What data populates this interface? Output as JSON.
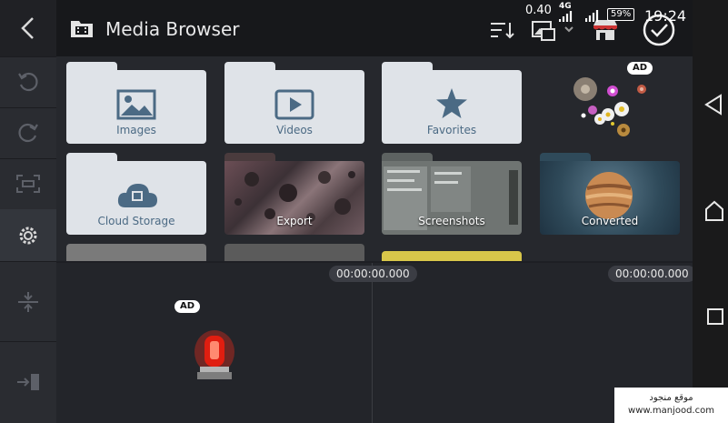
{
  "header": {
    "title": "Media Browser"
  },
  "status": {
    "speed": "0.40",
    "network": "4G",
    "battery": "59%",
    "time": "19:24"
  },
  "folders": [
    {
      "label": "Images"
    },
    {
      "label": "Videos"
    },
    {
      "label": "Favorites"
    },
    {
      "label": "Cloud Storage"
    },
    {
      "label": "Export"
    },
    {
      "label": "Screenshots"
    },
    {
      "label": "Converted"
    }
  ],
  "ads": {
    "grid_badge": "AD",
    "timeline_badge": "AD"
  },
  "timeline": {
    "timecode_left": "00:00:00.000",
    "timecode_right": "00:00:00.000"
  },
  "watermark": {
    "line1": "موقع منجود",
    "line2": "www.manjood.com"
  },
  "colors": {
    "accent": "#4b6a84",
    "folder": "#dfe3e8",
    "background": "#1e1f24"
  }
}
